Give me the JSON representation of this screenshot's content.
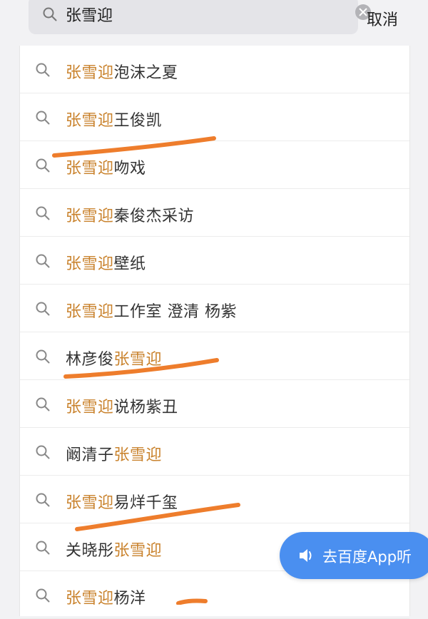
{
  "search": {
    "value": "张雪迎",
    "cancel_label": "取消"
  },
  "suggestions": [
    {
      "pre": "",
      "hl": "张雪迎",
      "post": "泡沫之夏"
    },
    {
      "pre": "",
      "hl": "张雪迎",
      "post": "王俊凯"
    },
    {
      "pre": "",
      "hl": "张雪迎",
      "post": "吻戏"
    },
    {
      "pre": "",
      "hl": "张雪迎",
      "post": "秦俊杰采访"
    },
    {
      "pre": "",
      "hl": "张雪迎",
      "post": "壁纸"
    },
    {
      "pre": "",
      "hl": "张雪迎",
      "post": "工作室 澄清 杨紫"
    },
    {
      "pre": "林彦俊",
      "hl": "张雪迎",
      "post": ""
    },
    {
      "pre": "",
      "hl": "张雪迎",
      "post": "说杨紫丑"
    },
    {
      "pre": "阚清子",
      "hl": "张雪迎",
      "post": ""
    },
    {
      "pre": "",
      "hl": "张雪迎",
      "post": "易烊千玺"
    },
    {
      "pre": "关晓彤",
      "hl": "张雪迎",
      "post": ""
    },
    {
      "pre": "",
      "hl": "张雪迎",
      "post": "杨洋"
    }
  ],
  "listen_button": {
    "label": "去百度App听"
  },
  "colors": {
    "highlight": "#c9822c",
    "annotation_stroke": "#ee7d2c",
    "listen_button_bg": "#4a8ff0"
  }
}
